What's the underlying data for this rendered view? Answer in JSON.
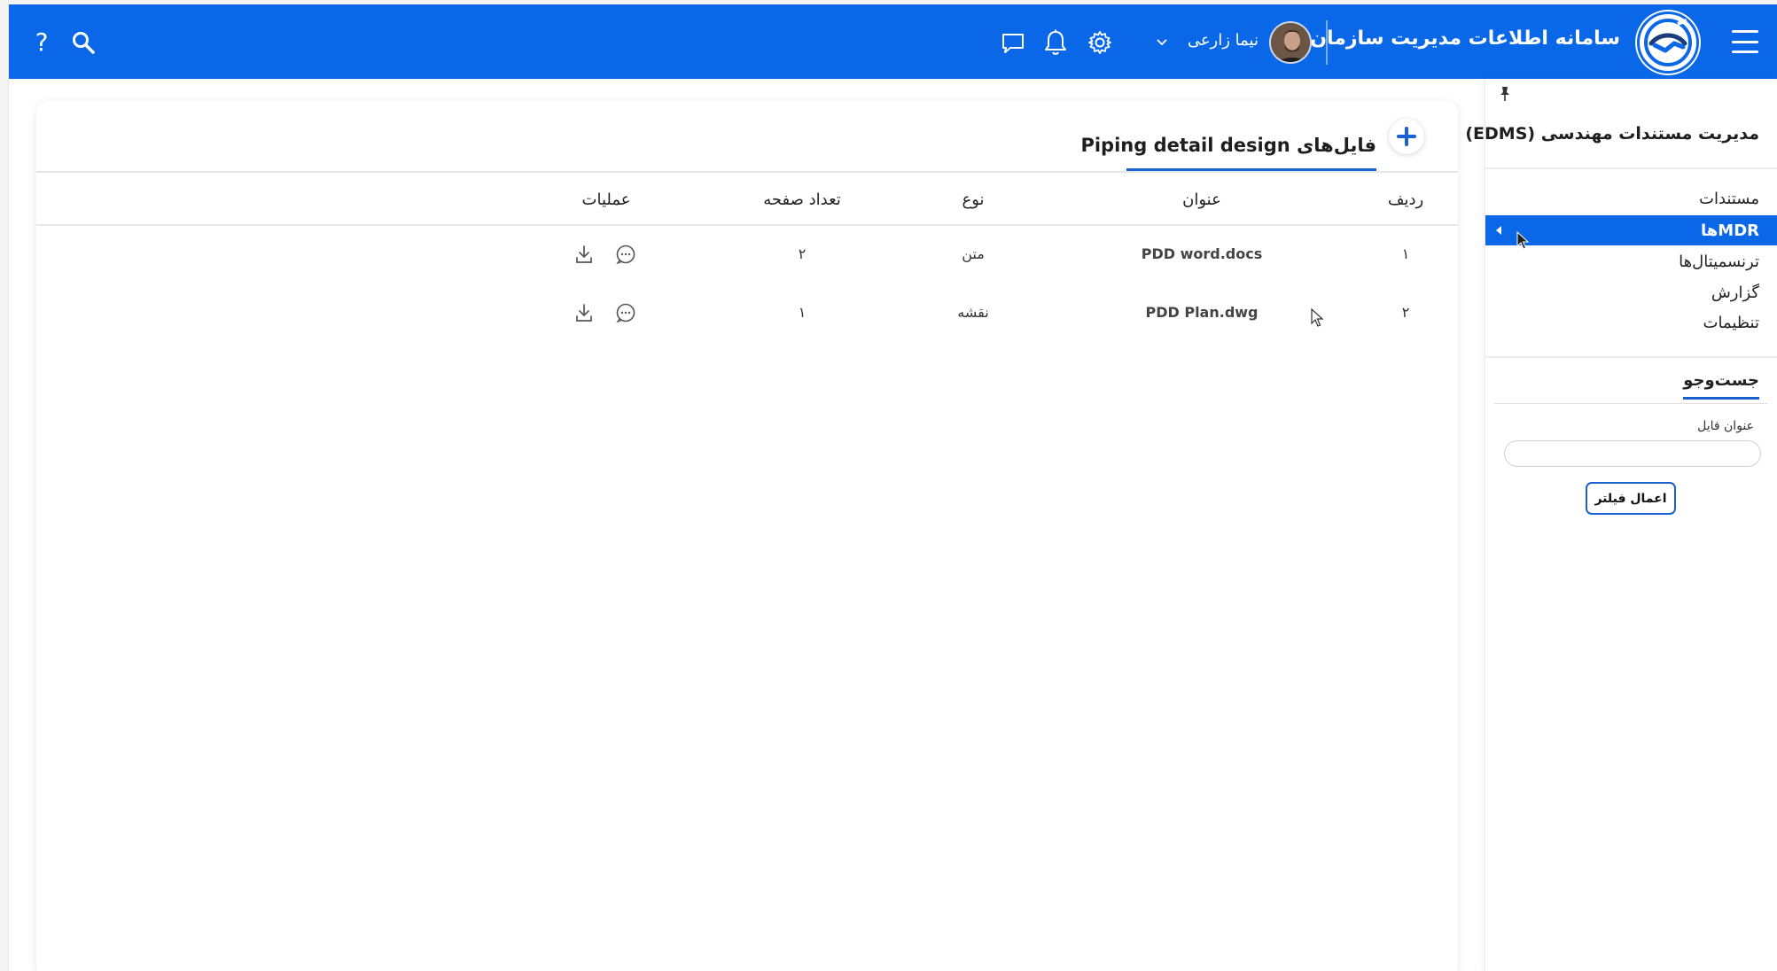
{
  "header": {
    "app_title": "سامانه اطلاعات مدیریت سازمان‌یار",
    "user_name": "نیما زارعی",
    "help_label": "?",
    "icons": [
      "menu-icon",
      "logo-handshake",
      "chevron-down-icon",
      "gear-icon",
      "bell-icon",
      "chat-icon",
      "search-icon",
      "help-icon"
    ]
  },
  "sidebar": {
    "title": "مدیریت مستندات مهندسی (EDMS)",
    "items": [
      {
        "label": "مستندات",
        "active": false
      },
      {
        "label": "MDRها",
        "active": true
      },
      {
        "label": "ترنسمیتال‌ها",
        "active": false
      },
      {
        "label": "گزارش",
        "active": false
      },
      {
        "label": "تنظیمات",
        "active": false
      }
    ],
    "search": {
      "section_title": "جست‌وجو",
      "field_label": "عنوان فایل",
      "field_value": "",
      "apply_button": "اعمال فیلتر"
    }
  },
  "main": {
    "tab_title": "فایل‌های Piping detail design",
    "table": {
      "columns": [
        "ردیف",
        "عنوان",
        "نوع",
        "تعداد صفحه",
        "عملیات"
      ],
      "rows": [
        {
          "index": "۱",
          "title": "PDD word.docs",
          "type": "متن",
          "pages": "۲"
        },
        {
          "index": "۲",
          "title": "PDD Plan.dwg",
          "type": "نقشه",
          "pages": "۱"
        }
      ]
    }
  },
  "colors": {
    "header_bg": "#0a68e8",
    "accent": "#1a62d1",
    "active_item_bg": "#0a68e8"
  }
}
